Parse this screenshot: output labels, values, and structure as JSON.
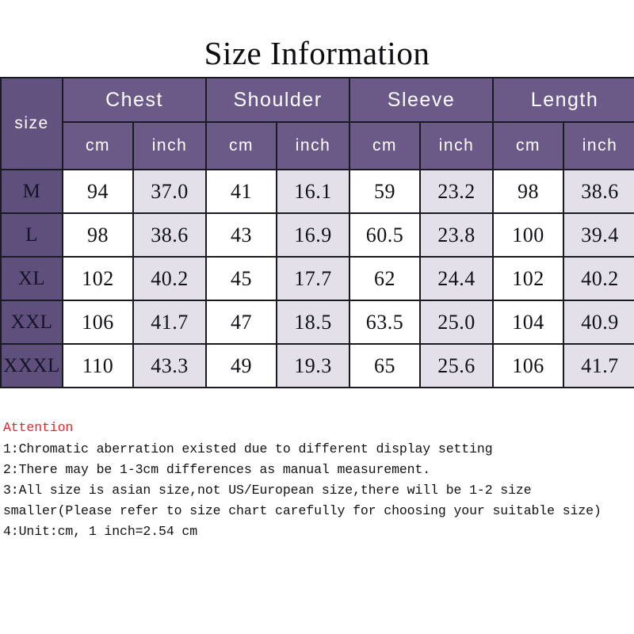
{
  "title": "Size Information",
  "table": {
    "size_header": "size",
    "groups": [
      "Chest",
      "Shoulder",
      "Sleeve",
      "Length"
    ],
    "units": [
      "cm",
      "inch"
    ],
    "unit_row": [
      "cm",
      "inch",
      "cm",
      "inch",
      "cm",
      "inch",
      "cm",
      "inch"
    ],
    "rows": [
      {
        "size": "M",
        "cells": [
          "94",
          "37.0",
          "41",
          "16.1",
          "59",
          "23.2",
          "98",
          "38.6"
        ]
      },
      {
        "size": "L",
        "cells": [
          "98",
          "38.6",
          "43",
          "16.9",
          "60.5",
          "23.8",
          "100",
          "39.4"
        ]
      },
      {
        "size": "XL",
        "cells": [
          "102",
          "40.2",
          "45",
          "17.7",
          "62",
          "24.4",
          "102",
          "40.2"
        ]
      },
      {
        "size": "XXL",
        "cells": [
          "106",
          "41.7",
          "47",
          "18.5",
          "63.5",
          "25.0",
          "104",
          "40.9"
        ]
      },
      {
        "size": "XXXL",
        "cells": [
          "110",
          "43.3",
          "49",
          "19.3",
          "65",
          "25.6",
          "106",
          "41.7"
        ]
      }
    ]
  },
  "notes": {
    "heading": "Attention",
    "lines": [
      "1:Chromatic aberration existed due to different display setting",
      "2:There may be 1-3cm differences as manual measurement.",
      "3:All size is asian size,not US/European size,there will be 1-2 size smaller(Please refer to size chart carefully for choosing your suitable size)",
      "4:Unit:cm, 1 inch=2.54 cm"
    ]
  },
  "colors": {
    "header_purple": "#6b5a87",
    "size_purple": "#5e4f7d",
    "inch_lavender": "#e4e0ea",
    "cm_white": "#ffffff",
    "attention_red": "#e4262c",
    "border": "#1a1a22"
  }
}
